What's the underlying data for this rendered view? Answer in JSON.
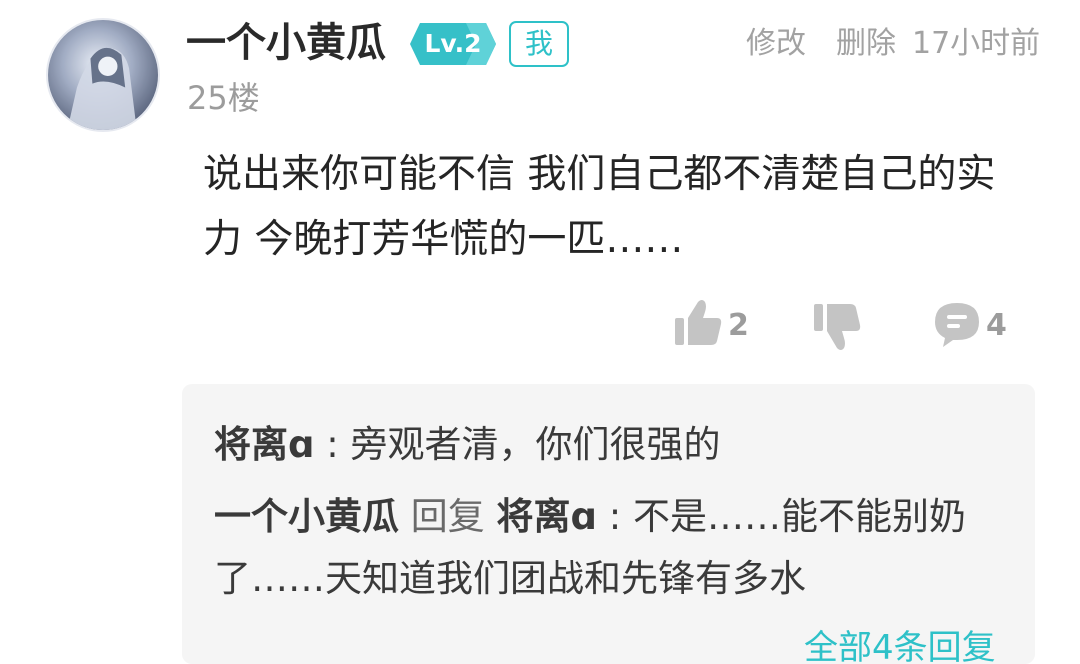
{
  "comment": {
    "username": "一个小黄瓜",
    "level": "Lv.2",
    "me_badge": "我",
    "floor": "25楼",
    "edit_label": "修改",
    "delete_label": "删除",
    "time": "17小时前",
    "body": "说出来你可能不信 我们自己都不清楚自己的实力 今晚打芳华慌的一匹……",
    "like_count": "2",
    "reply_count": "4"
  },
  "replies": [
    {
      "author": "将离ɑ",
      "separator": " : ",
      "text": "旁观者清，你们很强的"
    },
    {
      "author": "一个小黄瓜",
      "verb": " 回复 ",
      "target": "将离ɑ",
      "separator": " : ",
      "text": "不是……能不能别奶了……天知道我们团战和先锋有多水"
    }
  ],
  "more_replies": "全部4条回复",
  "icons": {
    "like": "thumbs-up-icon",
    "dislike": "thumbs-down-icon",
    "comment": "comment-bubble-icon"
  },
  "colors": {
    "accent": "#2ec1c8",
    "muted_text": "#9c9c9c",
    "reply_bg": "#f5f5f5"
  }
}
